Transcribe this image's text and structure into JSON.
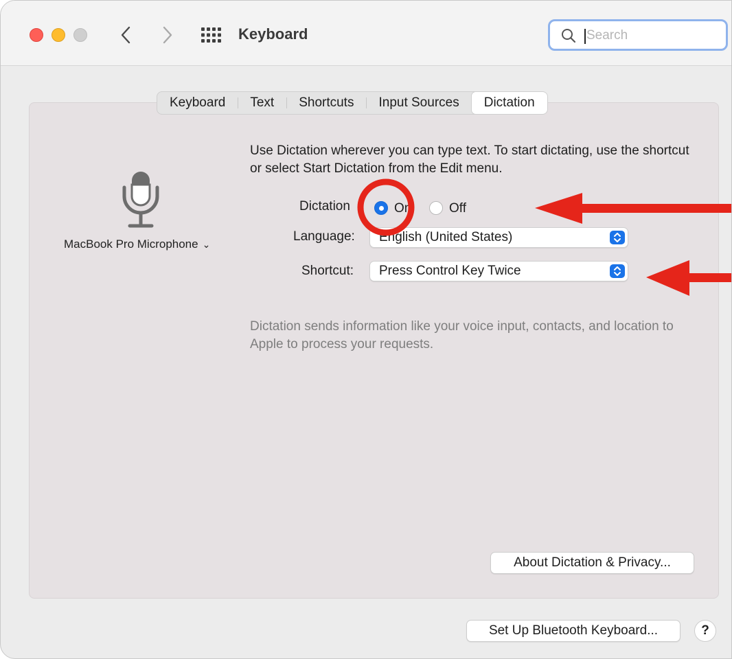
{
  "window": {
    "title": "Keyboard"
  },
  "search": {
    "placeholder": "Search",
    "value": ""
  },
  "tabs": [
    {
      "label": "Keyboard",
      "active": false
    },
    {
      "label": "Text",
      "active": false
    },
    {
      "label": "Shortcuts",
      "active": false
    },
    {
      "label": "Input Sources",
      "active": false
    },
    {
      "label": "Dictation",
      "active": true
    }
  ],
  "microphone": {
    "icon": "microphone-icon",
    "source_label": "MacBook Pro Microphone"
  },
  "dictation": {
    "description": "Use Dictation wherever you can type text. To start dictating, use the shortcut or select Start Dictation from the Edit menu.",
    "toggle_label": "Dictation",
    "on_label": "On",
    "off_label": "Off",
    "selected": "On",
    "language_label": "Language:",
    "language_value": "English (United States)",
    "shortcut_label": "Shortcut:",
    "shortcut_value": "Press Control Key Twice",
    "privacy_notice": "Dictation sends information like your voice input, contacts, and location to Apple to process your requests.",
    "about_button": "About Dictation & Privacy..."
  },
  "footer": {
    "bluetooth_button": "Set Up Bluetooth Keyboard...",
    "help_button": "?"
  },
  "colors": {
    "accent": "#1a73e8",
    "annotation": "#e5251a",
    "close": "#fe5f57",
    "minimize": "#febc2e"
  }
}
